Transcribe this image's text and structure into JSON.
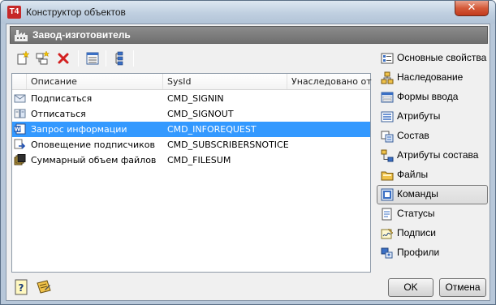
{
  "window": {
    "title": "Конструктор объектов",
    "app_icon_text": "T4",
    "close_symbol": "✕"
  },
  "header": {
    "title": "Завод-изготовитель"
  },
  "list": {
    "columns": [
      "Описание",
      "SysId",
      "Унаследовано от"
    ],
    "rows": [
      {
        "description": "Подписаться",
        "sysid": "CMD_SIGNIN",
        "inherited": "",
        "icon": "envelope-icon",
        "selected": false
      },
      {
        "description": "Отписаться",
        "sysid": "CMD_SIGNOUT",
        "inherited": "",
        "icon": "unsubscribe-icon",
        "selected": false
      },
      {
        "description": "Запрос информации",
        "sysid": "CMD_INFOREQUEST",
        "inherited": "",
        "icon": "word-document-icon",
        "selected": true
      },
      {
        "description": "Оповещение подписчиков",
        "sysid": "CMD_SUBSCRIBERSNOTICE",
        "inherited": "",
        "icon": "notify-arrow-icon",
        "selected": false
      },
      {
        "description": "Суммарный объем файлов",
        "sysid": "CMD_FILESUM",
        "inherited": "",
        "icon": "files-stack-icon",
        "selected": false
      }
    ]
  },
  "nav": {
    "items": [
      {
        "label": "Основные свойства",
        "icon": "properties-icon",
        "active": false
      },
      {
        "label": "Наследование",
        "icon": "inheritance-icon",
        "active": false
      },
      {
        "label": "Формы ввода",
        "icon": "input-forms-icon",
        "active": false
      },
      {
        "label": "Атрибуты",
        "icon": "attributes-icon",
        "active": false
      },
      {
        "label": "Состав",
        "icon": "composition-icon",
        "active": false
      },
      {
        "label": "Атрибуты состава",
        "icon": "composition-attributes-icon",
        "active": false
      },
      {
        "label": "Файлы",
        "icon": "files-icon",
        "active": false
      },
      {
        "label": "Команды",
        "icon": "commands-icon",
        "active": true
      },
      {
        "label": "Статусы",
        "icon": "statuses-icon",
        "active": false
      },
      {
        "label": "Подписи",
        "icon": "signatures-icon",
        "active": false
      },
      {
        "label": "Профили",
        "icon": "profiles-icon",
        "active": false
      }
    ]
  },
  "buttons": {
    "ok": "OK",
    "cancel": "Отмена"
  },
  "colors": {
    "selection": "#3399ff",
    "header_bg": "#7a7a7a",
    "accent_red": "#c62828"
  }
}
